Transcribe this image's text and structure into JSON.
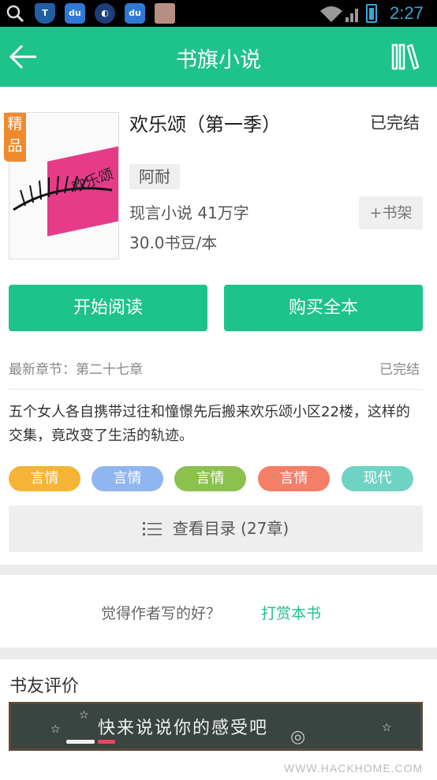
{
  "status_bar": {
    "time": "2:27",
    "icons": [
      "search-icon",
      "shield-icon",
      "baidu-icon",
      "app-circle-icon",
      "baidu-icon",
      "photo-icon",
      "wifi-icon",
      "signal-icon",
      "battery-icon"
    ]
  },
  "appbar": {
    "title": "书旗小说",
    "back_icon": "arrow-left-icon",
    "shelf_icon": "bookshelf-icon"
  },
  "book": {
    "badge": "精品",
    "cover_title": "欢乐颂",
    "title": "欢乐颂（第一季）",
    "status": "已完结",
    "author": "阿耐",
    "category_words": "现言小说  41万字",
    "price": "30.0书豆/本",
    "add_to_shelf": "+书架"
  },
  "actions": {
    "start_reading": "开始阅读",
    "buy_all": "购买全本"
  },
  "chapter": {
    "latest": "最新章节：第二十七章",
    "status": "已完结"
  },
  "description": "五个女人各自携带过往和憧憬先后搬来欢乐颂小区22楼，这样的交集，竟改变了生活的轨迹。",
  "tags": [
    {
      "label": "言情",
      "color": "#f5b435"
    },
    {
      "label": "言情",
      "color": "#8fb6ef"
    },
    {
      "label": "言情",
      "color": "#8cc04f"
    },
    {
      "label": "言情",
      "color": "#f47e66"
    },
    {
      "label": "现代",
      "color": "#6ed3c2"
    }
  ],
  "catalog": "查看目录 (27章)",
  "tip": {
    "question": "觉得作者写的好？",
    "reward": "打赏本书"
  },
  "comments": {
    "header": "书友评价",
    "prompt": "快来说说你的感受吧"
  },
  "watermark": "WWW.HACKHOME.COM"
}
